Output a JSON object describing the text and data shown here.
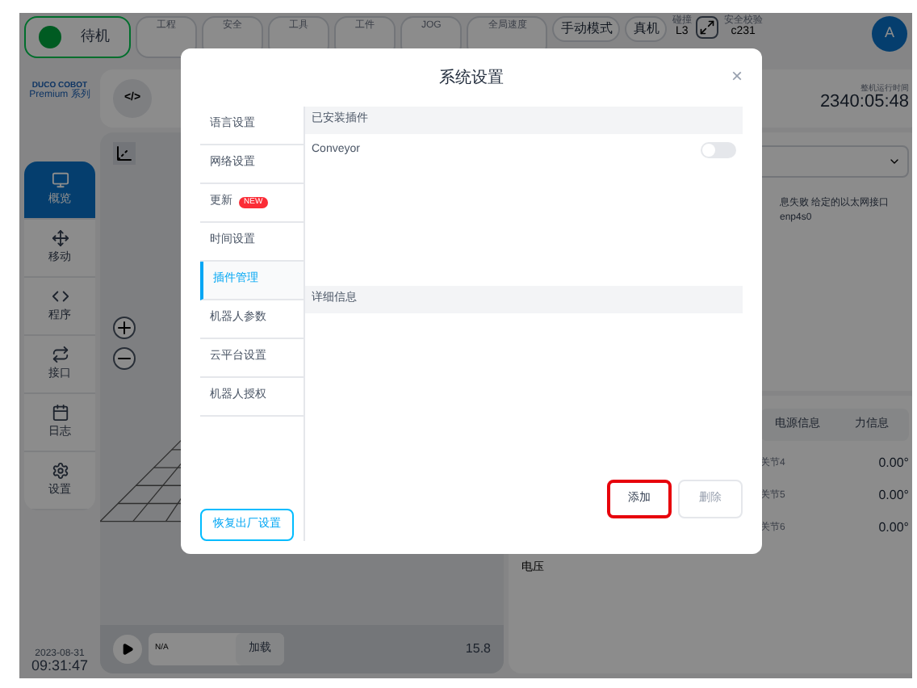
{
  "status": {
    "label": "待机"
  },
  "top_groups": [
    {
      "label": "工程"
    },
    {
      "label": "安全"
    },
    {
      "label": "工具"
    },
    {
      "label": "工件"
    },
    {
      "label": "JOG"
    },
    {
      "label": "全局速度"
    }
  ],
  "mode_buttons": [
    "手动模式",
    "真机"
  ],
  "collision": {
    "label": "碰撞",
    "value": "L3"
  },
  "safety_check": {
    "label": "安全校验",
    "value": "c231"
  },
  "avatar": "A",
  "logo": {
    "name": "DUCO COBOT",
    "series": "Premium 系列"
  },
  "nav": [
    {
      "label": "概览",
      "selected": true
    },
    {
      "label": "移动",
      "selected": false
    },
    {
      "label": "程序",
      "selected": false
    },
    {
      "label": "接口",
      "selected": false
    },
    {
      "label": "日志",
      "selected": false
    },
    {
      "label": "设置",
      "selected": false
    }
  ],
  "datetime": {
    "date": "2023-08-31",
    "time": "09:31:47"
  },
  "code_button": "</>",
  "player": {
    "program": "N/A",
    "load": "加载",
    "value": "15.8"
  },
  "runtime": {
    "label": "整机运行时间",
    "value": "2340:05:48"
  },
  "error_text": "息失败 给定的以太网接口 enp4s0",
  "info_tabs": [
    "电源信息",
    "力信息"
  ],
  "joints": [
    {
      "name": "关节4",
      "value": "0.00°"
    },
    {
      "name": "关节5",
      "value": "0.00°"
    },
    {
      "name": "关节6",
      "value": "0.00°"
    }
  ],
  "voltage_label": "电压",
  "dialog": {
    "title": "系统设置",
    "close": "×",
    "menu": [
      {
        "label": "语言设置",
        "selected": false
      },
      {
        "label": "网络设置",
        "selected": false
      },
      {
        "label": "更新",
        "badge": "NEW",
        "selected": false
      },
      {
        "label": "时间设置",
        "selected": false
      },
      {
        "label": "插件管理",
        "selected": true
      },
      {
        "label": "机器人参数",
        "selected": false
      },
      {
        "label": "云平台设置",
        "selected": false
      },
      {
        "label": "机器人授权",
        "selected": false
      }
    ],
    "reset_button": "恢复出厂设置",
    "installed_header": "已安装插件",
    "plugins": [
      {
        "name": "Conveyor",
        "on": false
      }
    ],
    "details_header": "详细信息",
    "buttons": [
      {
        "label": "添加",
        "disabled": false,
        "highlighted": true
      },
      {
        "label": "删除",
        "disabled": true,
        "highlighted": false
      }
    ]
  }
}
